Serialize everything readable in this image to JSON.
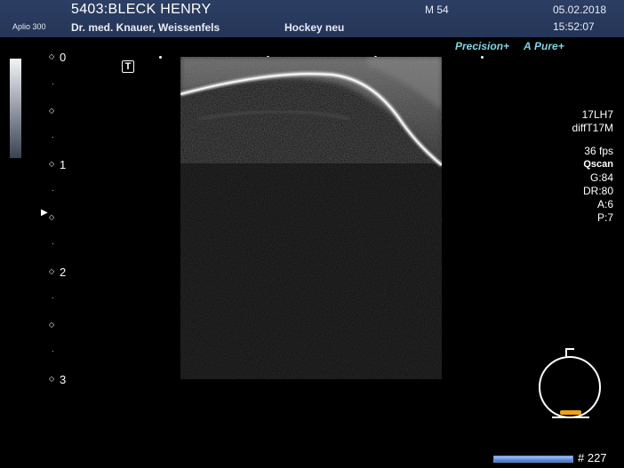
{
  "header": {
    "model": "Aplio 300",
    "patient": "5403:BLECK HENRY",
    "doctor": "Dr. med. Knauer, Weissenfels",
    "exam": "Hockey neu",
    "mode": "M 54",
    "date": "05.02.2018",
    "time": "15:52:07"
  },
  "badges": {
    "precision": "Precision",
    "precision_plus": "+",
    "pure_a": "A",
    "pure": "Pure",
    "pure_plus": "+"
  },
  "depth_scale": {
    "labels": [
      "0",
      "1",
      "2",
      "3"
    ]
  },
  "t_marker": "T",
  "params": {
    "probe": "17LH7",
    "preset": "diffT17M",
    "fps": "36 fps",
    "qscan": "Qscan",
    "gain": "G:84",
    "dynamic_range": "DR:80",
    "a": "A:6",
    "p": "P:7"
  },
  "frame": {
    "count": "# 227",
    "progress": 1.0
  },
  "colors": {
    "header_bg": "#2c3e63",
    "accent_cyan": "#7fd6e0",
    "probe_marker": "#f0a01c",
    "frame_bar": "#3e6fc6"
  }
}
